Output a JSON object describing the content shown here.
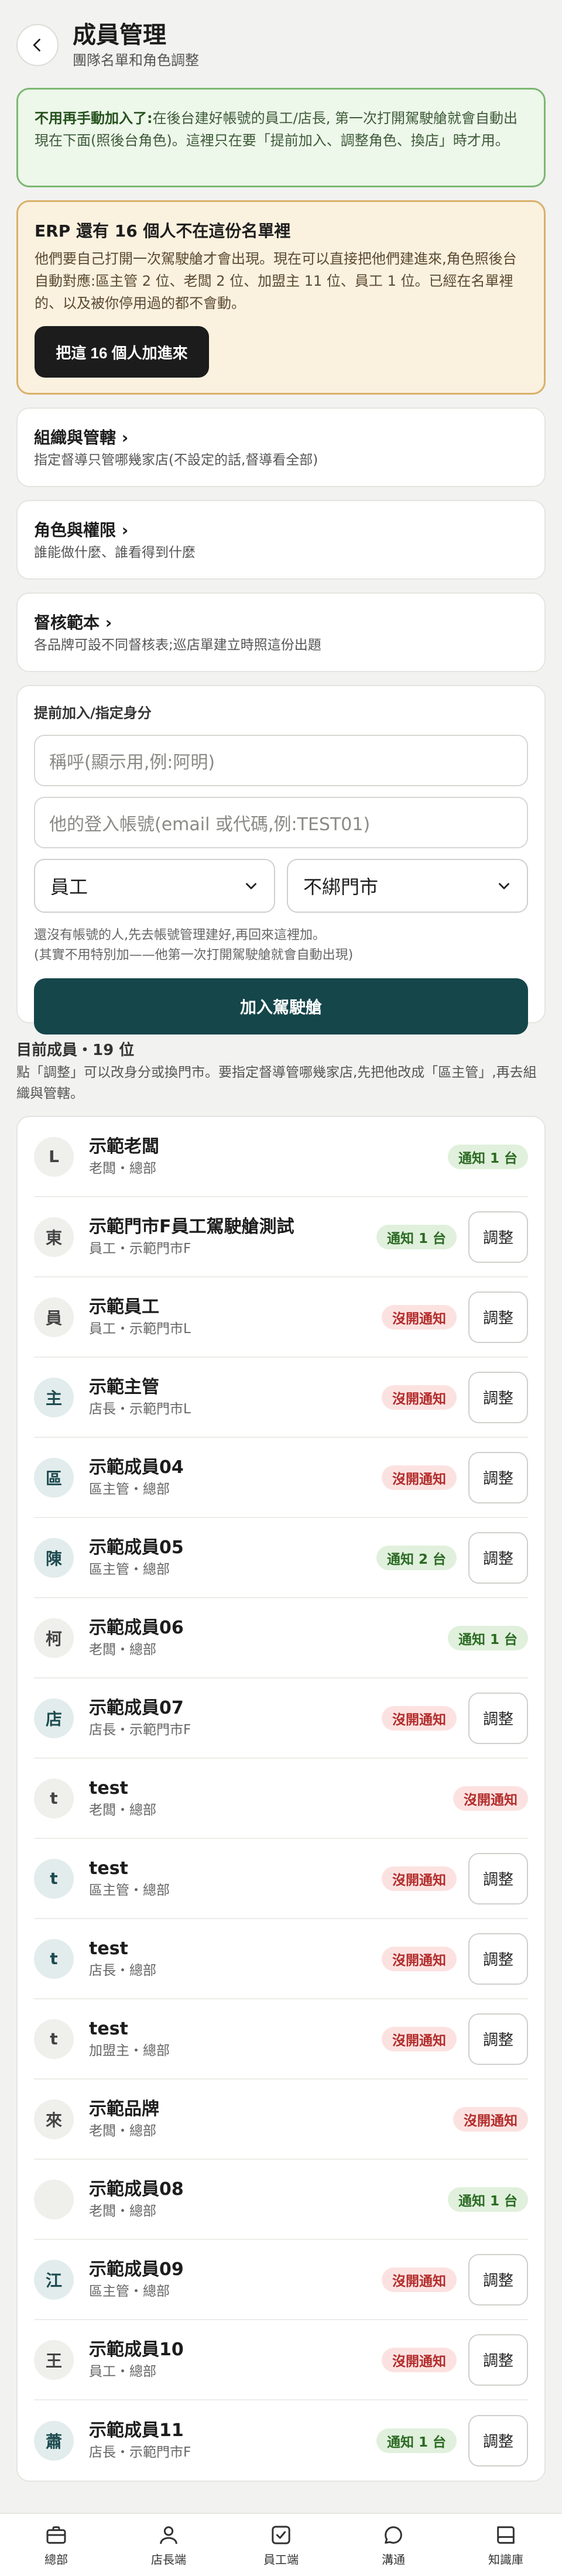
{
  "header": {
    "title": "成員管理",
    "subtitle": "團隊名單和角色調整"
  },
  "notice": {
    "bold": "不用再手動加入了:",
    "text": "在後台建好帳號的員工/店長, 第一次打開駕駛艙就會自動出現在下面(照後台角色)。這裡只在要「提前加入、調整角色、換店」時才用。"
  },
  "erp": {
    "title": "ERP 還有 16 個人不在這份名單裡",
    "body": "他們要自己打開一次駕駛艙才會出現。現在可以直接把他們建進來,角色照後台自動對應:區主管 2 位、老闆 2 位、加盟主 11 位、員工 1 位。已經在名單裡的、以及被你停用過的都不會動。",
    "button": "把這 16 個人加進來"
  },
  "sections": [
    {
      "title": "組織與管轄 ›",
      "desc": "指定督導只管哪幾家店(不設定的話,督導看全部)"
    },
    {
      "title": "角色與權限 ›",
      "desc": "誰能做什麼、誰看得到什麼"
    },
    {
      "title": "督核範本 ›",
      "desc": "各品牌可設不同督核表;巡店單建立時照這份出題"
    }
  ],
  "form": {
    "label": "提前加入/指定身分",
    "nickname_placeholder": "稱呼(顯示用,例:阿明)",
    "account_placeholder": "他的登入帳號(email 或代碼,例:TEST01)",
    "role_value": "員工",
    "store_value": "不綁門市",
    "hint1": "還沒有帳號的人,先去帳號管理建好,再回來這裡加。",
    "hint2": "(其實不用特別加——他第一次打開駕駛艙就會自動出現)",
    "submit": "加入駕駛艙"
  },
  "members_section": {
    "heading": "目前成員・19 位",
    "desc": "點「調整」可以改身分或換門市。要指定督導管哪幾家店,先把他改成「區主管」,再去組織與管轄。",
    "adjust_label": "調整"
  },
  "members": [
    {
      "avatar": "L",
      "name": "示範老闆",
      "role": "老闆・總部",
      "badge": "通知 1 台",
      "status": "ok",
      "adjust": false,
      "teal": false
    },
    {
      "avatar": "東",
      "name": "示範門市F員工駕駛艙測試",
      "role": "員工・示範門市F",
      "badge": "通知 1 台",
      "status": "ok",
      "adjust": true,
      "teal": false
    },
    {
      "avatar": "員",
      "name": "示範員工",
      "role": "員工・示範門市L",
      "badge": "沒開通知",
      "status": "no",
      "adjust": true,
      "teal": false
    },
    {
      "avatar": "主",
      "name": "示範主管",
      "role": "店長・示範門市L",
      "badge": "沒開通知",
      "status": "no",
      "adjust": true,
      "teal": true
    },
    {
      "avatar": "區",
      "name": "示範成員04",
      "role": "區主管・總部",
      "badge": "沒開通知",
      "status": "no",
      "adjust": true,
      "teal": true
    },
    {
      "avatar": "陳",
      "name": "示範成員05",
      "role": "區主管・總部",
      "badge": "通知 2 台",
      "status": "ok",
      "adjust": true,
      "teal": true
    },
    {
      "avatar": "柯",
      "name": "示範成員06",
      "role": "老闆・總部",
      "badge": "通知 1 台",
      "status": "ok",
      "adjust": false,
      "teal": false
    },
    {
      "avatar": "店",
      "name": "示範成員07",
      "role": "店長・示範門市F",
      "badge": "沒開通知",
      "status": "no",
      "adjust": true,
      "teal": true
    },
    {
      "avatar": "t",
      "name": "test",
      "role": "老闆・總部",
      "badge": "沒開通知",
      "status": "no",
      "adjust": false,
      "teal": false
    },
    {
      "avatar": "t",
      "name": "test",
      "role": "區主管・總部",
      "badge": "沒開通知",
      "status": "no",
      "adjust": true,
      "teal": true
    },
    {
      "avatar": "t",
      "name": "test",
      "role": "店長・總部",
      "badge": "沒開通知",
      "status": "no",
      "adjust": true,
      "teal": true
    },
    {
      "avatar": "t",
      "name": "test",
      "role": "加盟主・總部",
      "badge": "沒開通知",
      "status": "no",
      "adjust": true,
      "teal": false
    },
    {
      "avatar": "來",
      "name": "示範品牌",
      "role": "老闆・總部",
      "badge": "沒開通知",
      "status": "no",
      "adjust": false,
      "teal": false
    },
    {
      "avatar": "",
      "name": "示範成員08",
      "role": "老闆・總部",
      "badge": "通知 1 台",
      "status": "ok",
      "adjust": false,
      "teal": false
    },
    {
      "avatar": "江",
      "name": "示範成員09",
      "role": "區主管・總部",
      "badge": "沒開通知",
      "status": "no",
      "adjust": true,
      "teal": true
    },
    {
      "avatar": "王",
      "name": "示範成員10",
      "role": "員工・總部",
      "badge": "沒開通知",
      "status": "no",
      "adjust": true,
      "teal": false
    },
    {
      "avatar": "蕭",
      "name": "示範成員11",
      "role": "店長・示範門市F",
      "badge": "通知 1 台",
      "status": "ok",
      "adjust": true,
      "teal": true
    }
  ],
  "nav": [
    {
      "label": "總部",
      "icon": "briefcase-icon"
    },
    {
      "label": "店長端",
      "icon": "person-icon"
    },
    {
      "label": "員工端",
      "icon": "checkbox-icon"
    },
    {
      "label": "溝通",
      "icon": "chat-bubble-icon"
    },
    {
      "label": "知識庫",
      "icon": "book-icon"
    }
  ],
  "colors": {
    "accent": "#15464a",
    "ok_badge": "#e0f0dc",
    "no_badge": "#fbe2e1",
    "notice_border": "#7cb872",
    "erp_border": "#d9b06b"
  }
}
